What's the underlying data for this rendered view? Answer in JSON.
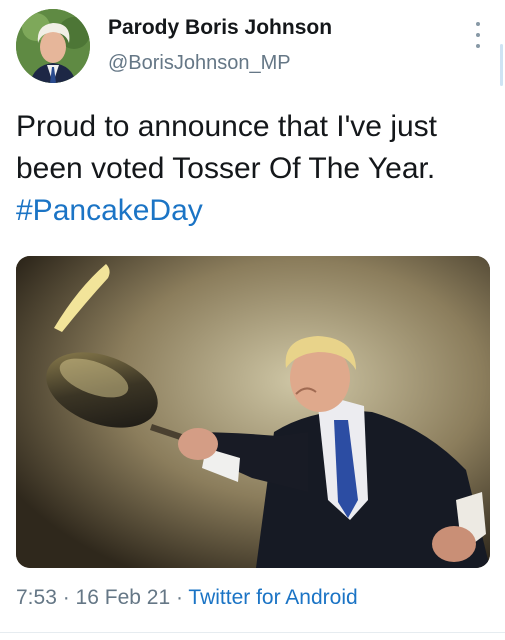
{
  "author": {
    "name": "Parody Boris Johnson",
    "handle": "@BorisJohnson_MP"
  },
  "tweet": {
    "text": "Proud to announce that I've just been voted Tosser Of The Year.",
    "hashtag": "#PancakeDay"
  },
  "meta": {
    "time": "7:53",
    "separator": " · ",
    "date": "16 Feb 21",
    "source": "Twitter for Android"
  },
  "icons": {
    "more": "more-vertical-icon"
  },
  "colors": {
    "link": "#1b74c5",
    "secondary_text": "#657786",
    "primary_text": "#14171a"
  }
}
